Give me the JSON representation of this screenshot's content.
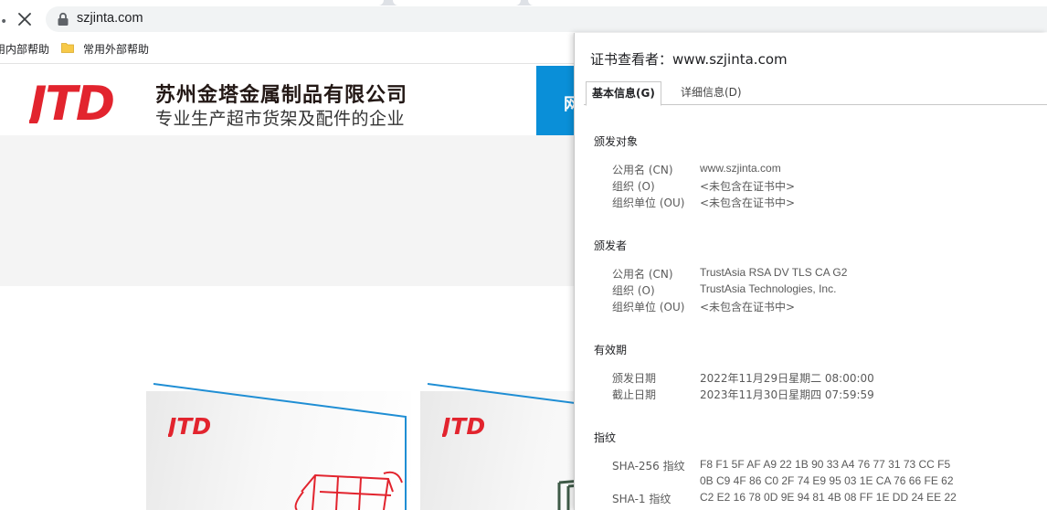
{
  "browser": {
    "nav_dot": "•",
    "url": "szjinta.com",
    "bookmarks": [
      "用内部帮助",
      "常用外部帮助"
    ]
  },
  "site": {
    "logo_text": "JTD",
    "company_name": "苏州金塔金属制品有限公司",
    "slogan": "专业生产超市货架及配件的企业",
    "nav_partial": "网",
    "brand_color": "#e2242e",
    "accent_color": "#0a8fd8"
  },
  "cert": {
    "title": "证书查看者：www.szjinta.com",
    "tabs": [
      {
        "label": "基本信息(G)",
        "active": true
      },
      {
        "label": "详细信息(D)",
        "active": false
      }
    ],
    "issued_to": {
      "heading": "颁发对象",
      "fields": [
        {
          "label": "公用名 (CN)",
          "value": "www.szjinta.com"
        },
        {
          "label": "组织 (O)",
          "value": "<未包含在证书中>"
        },
        {
          "label": "组织单位 (OU)",
          "value": "<未包含在证书中>"
        }
      ]
    },
    "issued_by": {
      "heading": "颁发者",
      "fields": [
        {
          "label": "公用名 (CN)",
          "value": "TrustAsia RSA DV TLS CA G2"
        },
        {
          "label": "组织 (O)",
          "value": "TrustAsia Technologies, Inc."
        },
        {
          "label": "组织单位 (OU)",
          "value": "<未包含在证书中>"
        }
      ]
    },
    "validity": {
      "heading": "有效期",
      "fields": [
        {
          "label": "颁发日期",
          "value": "2022年11月29日星期二 08:00:00"
        },
        {
          "label": "截止日期",
          "value": "2023年11月30日星期四 07:59:59"
        }
      ]
    },
    "fingerprints": {
      "heading": "指纹",
      "sha256_label": "SHA-256 指纹",
      "sha256_line1": "F8 F1 5F AF A9 22 1B 90 33 A4 76 77 31 73 CC F5",
      "sha256_line2": "0B C9 4F 86 C0 2F 74 E9 95 03 1E CA 76 66 FE 62",
      "sha1_label": "SHA-1 指纹",
      "sha1_line1": "C2 E2 16 78 0D 9E 94 81 4B 08 FF 1E DD 24 EE 22"
    }
  }
}
